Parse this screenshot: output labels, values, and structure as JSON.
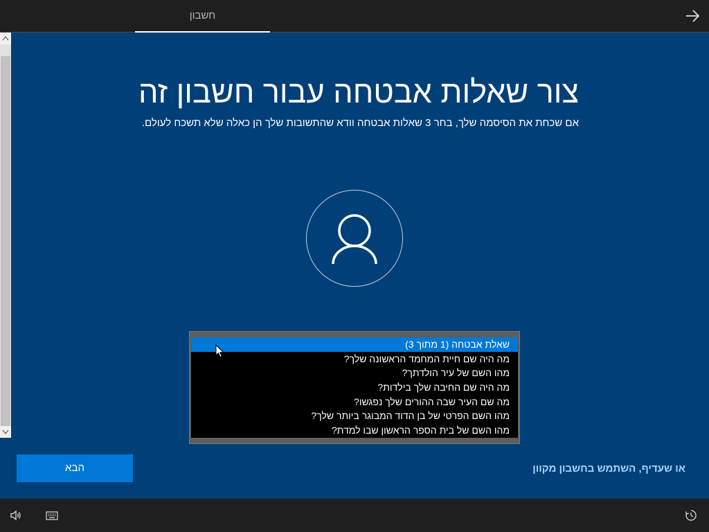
{
  "top_bar": {
    "tab_label": "חשבון",
    "forward_icon": "arrow-right-icon"
  },
  "page": {
    "title": "צור שאלות אבטחה עבור חשבון זה",
    "subtitle": "אם שכחת את הסיסמה שלך, בחר 3 שאלות אבטחה וודא שהתשובות שלך הן כאלה שלא תשכח לעולם."
  },
  "avatar": {
    "icon": "user-icon"
  },
  "dropdown": {
    "highlighted_index": 0,
    "options": [
      "שאלת אבטחה (1 מתוך 3)",
      "מה היה שם חיית המחמד הראשונה שלך?",
      "מהו השם של עיר הולדתך?",
      "מה היה שם החיבה שלך בילדות?",
      "מה שם העיר שבה ההורים שלך נפגשו?",
      "מהו השם הפרטי של בן הדוד המבוגר ביותר שלך?",
      "מהו השם של בית הספר הראשון שבו למדת?"
    ]
  },
  "actions": {
    "next_label": "הבא",
    "online_account_link": "או שעדיף, השתמש בחשבון מקוון"
  },
  "bottom_bar": {
    "icons": [
      "volume-icon",
      "keyboard-icon",
      "accessibility-icon"
    ]
  },
  "colors": {
    "background": "#003f77",
    "accent": "#0078d7",
    "link": "#a6d4ff",
    "bars": "#1f1f1f"
  }
}
